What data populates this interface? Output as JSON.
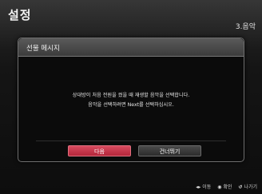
{
  "header": {
    "title": "설정",
    "step": "3.음악"
  },
  "dialog": {
    "title": "선물 메시지",
    "message_line1": "상대방이 처음 전원을 켰을 때 재생할 음악을 선택합니다.",
    "message_line2": "음악을 선택하려면 Next를 선택하십시오."
  },
  "buttons": {
    "next_label": "다음",
    "skip_label": "건너뛰기"
  },
  "footer": {
    "move_icon": "◂▸",
    "move_label": "이동",
    "confirm_icon": "◉",
    "confirm_label": "확인",
    "back_icon": "↺",
    "back_label": "나가기"
  },
  "colors": {
    "accent": "#c5303f",
    "background": "#111111"
  }
}
